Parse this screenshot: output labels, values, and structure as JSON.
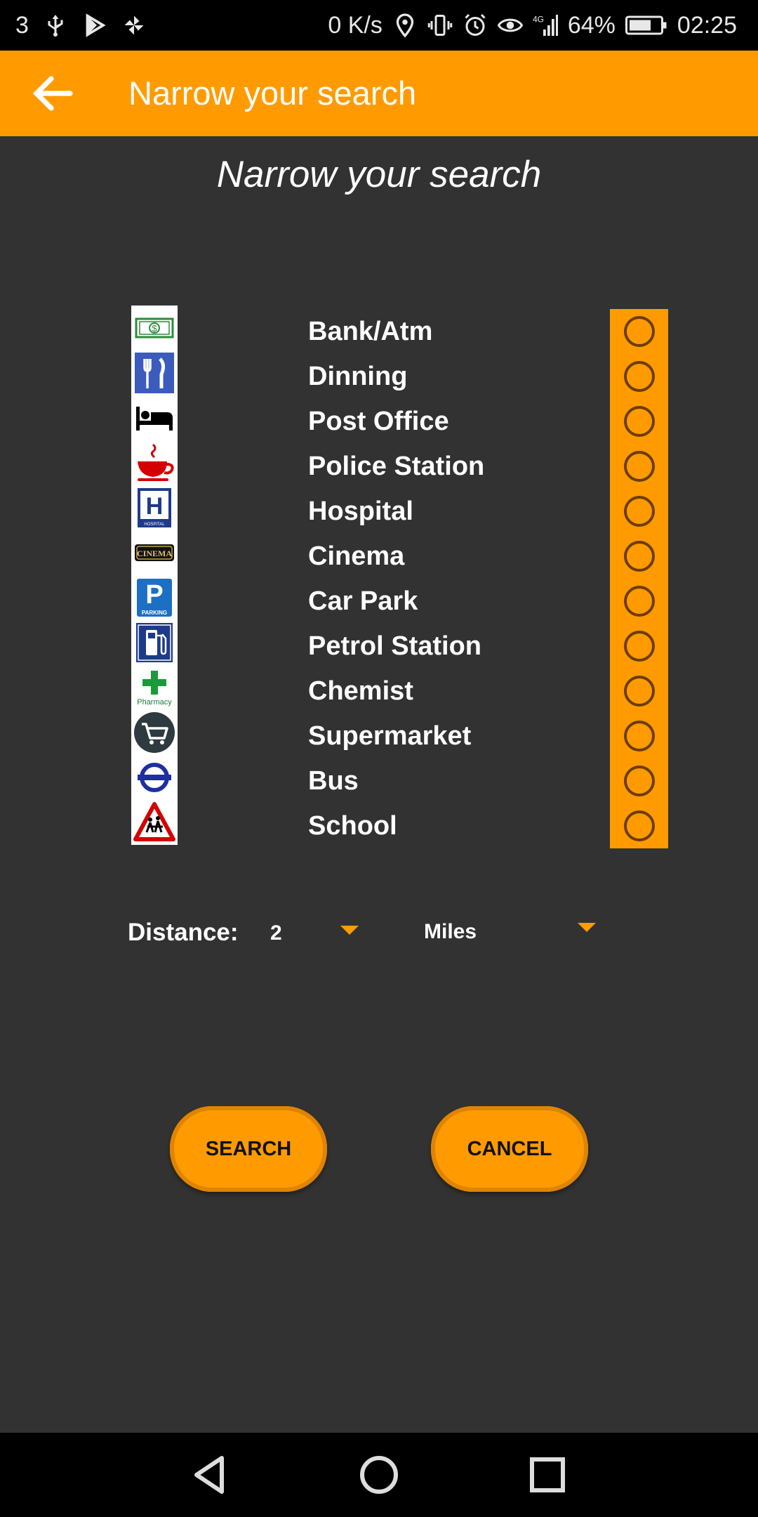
{
  "status_bar": {
    "carrier": "3",
    "net_speed": "0 K/s",
    "network": "4G",
    "battery": "64%",
    "time": "02:25"
  },
  "app_bar": {
    "title": "Narrow your search"
  },
  "heading": "Narrow your search",
  "categories": [
    {
      "label": "Bank/Atm",
      "icon": "money-icon"
    },
    {
      "label": "Dinning",
      "icon": "fork-knife-icon"
    },
    {
      "label": "Post Office",
      "icon": "bed-icon"
    },
    {
      "label": "Police Station",
      "icon": "coffee-cup-icon"
    },
    {
      "label": "Hospital",
      "icon": "hospital-icon",
      "icon_text": "HOSPITAL"
    },
    {
      "label": "Cinema",
      "icon": "cinema-icon",
      "icon_text": "CINEMA"
    },
    {
      "label": "Car Park",
      "icon": "parking-icon",
      "icon_text": "PARKING"
    },
    {
      "label": "Petrol Station",
      "icon": "fuel-pump-icon"
    },
    {
      "label": "Chemist",
      "icon": "pharmacy-icon",
      "icon_text": "Pharmacy"
    },
    {
      "label": "Supermarket",
      "icon": "shopping-cart-icon"
    },
    {
      "label": "Bus",
      "icon": "underground-roundel-icon"
    },
    {
      "label": "School",
      "icon": "school-sign-icon"
    }
  ],
  "distance": {
    "label": "Distance:",
    "value": "2",
    "unit": "Miles"
  },
  "buttons": {
    "search": "SEARCH",
    "cancel": "CANCEL"
  },
  "colors": {
    "accent": "#ff9b00",
    "background": "#323232"
  }
}
